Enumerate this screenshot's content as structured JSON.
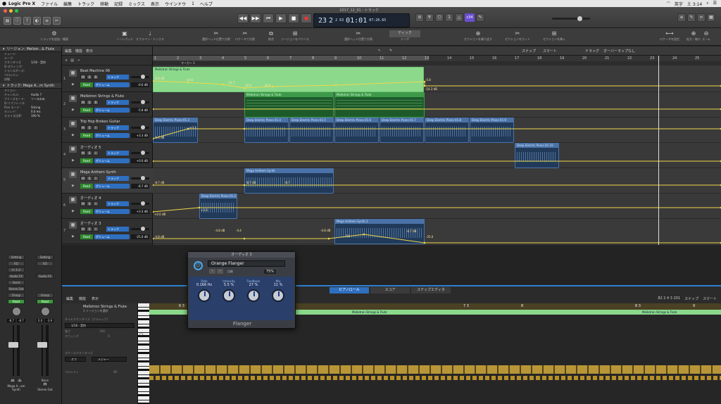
{
  "menubar": {
    "app": "Logic Pro X",
    "items": [
      "ファイル",
      "編集",
      "トラック",
      "移動",
      "記録",
      "ミックス",
      "表示",
      "ウインドウ",
      "1",
      "ヘルプ"
    ],
    "right": [
      "英字",
      "土 3:14"
    ]
  },
  "window": {
    "title": "2017_12_01 - トラック"
  },
  "lcd": {
    "bar": "23",
    "beat": "2",
    "sub": "2",
    "tick": "63",
    "time": "01:01",
    "ms": "07:20.65"
  },
  "cpu_badge": "c34",
  "toolbar": {
    "items": [
      "トラックを追加／複製",
      "ノートパッド",
      "オフライン・ミックス",
      "選択ヘッド位置で分割",
      "ロケータで分割",
      "結合",
      "リージョンをバウンス",
      "選択ヘッド位置で分割",
      "ティック",
      "テンポ",
      "セクションを繰り返す",
      "セクションをカット",
      "セクションを挿入",
      "ロケータを設定",
      "拡大／縮小",
      "ズーム"
    ]
  },
  "inspector": {
    "region_label": "リージョン: Mellotr...& Flute",
    "rows": [
      {
        "k": "ミュート:",
        "v": ""
      },
      {
        "k": "ループ:",
        "v": ""
      },
      {
        "k": "クオンタイズ",
        "v": "1/16 - 音符"
      },
      {
        "k": "Q-スウィング:",
        "v": ""
      },
      {
        "k": "トランスポーズ:",
        "v": ""
      },
      {
        "k": "ベロシティ:",
        "v": ""
      },
      {
        "k": "詳細",
        "v": ""
      }
    ],
    "track_label": "トラック: Mega A...m Synth",
    "track_rows": [
      {
        "k": "アイコン:",
        "v": ""
      },
      {
        "k": "チャンネル:",
        "v": "Audio 7"
      },
      {
        "k": "フリーズモード:",
        "v": "ソースのみ"
      },
      {
        "k": "Q-リファレンス:",
        "v": ""
      },
      {
        "k": "Flex モード:",
        "v": "Slicing"
      },
      {
        "k": "ディレイ:",
        "v": "0.0 ms"
      },
      {
        "k": "スライス比率:",
        "v": "100 %"
      }
    ]
  },
  "strips": [
    {
      "setting": "Setting",
      "eq": "EQ",
      "input": "In 1-2",
      "fx": "Audio FX",
      "send": "Send",
      "out": "Stereo Out",
      "group": "Group",
      "auto": "Read",
      "db1": "-8.7",
      "db2": "-8.7",
      "name": "Mega A...am Synth"
    },
    {
      "setting": "Setting",
      "eq": "EQ",
      "input": "",
      "fx": "Audio FX",
      "send": "",
      "out": "",
      "group": "Group",
      "auto": "Read",
      "db1": "0.0",
      "db2": "-3.9",
      "name": "Stereo Out",
      "bnce": "Bnce"
    }
  ],
  "tracklist": {
    "top": [
      "編集",
      "機能",
      "表示"
    ],
    "tracks": [
      {
        "num": "1",
        "name": "Beat Machine 06",
        "btn": "トラック",
        "auto": "Read",
        "vol": "ボリューム",
        "db": "-6.6 dB"
      },
      {
        "num": "2",
        "name": "Mellotron Strings & Flute",
        "btn": "トラック",
        "auto": "Read",
        "vol": "ボリューム",
        "db": "-5.8 dB"
      },
      {
        "num": "3",
        "name": "Trip Hop Broken Guitar",
        "btn": "トラック",
        "auto": "Read",
        "vol": "ボリューム",
        "db": "+3.3 dB"
      },
      {
        "num": "4",
        "name": "オーディオ 5",
        "btn": "トラック",
        "auto": "Read",
        "vol": "ボリューム",
        "db": "+0.0 dB"
      },
      {
        "num": "5",
        "name": "Mega Anthem Synth",
        "btn": "トラック",
        "auto": "Read",
        "vol": "ボリューム",
        "db": "-8.7 dB"
      },
      {
        "num": "6",
        "name": "オーディオ 4",
        "btn": "トラック",
        "auto": "Read",
        "vol": "ボリューム",
        "db": "+3.3 dB"
      },
      {
        "num": "7",
        "name": "オーディオ 3",
        "btn": "トラック",
        "auto": "Read",
        "vol": "ボリューム",
        "db": "-25.0 dB"
      }
    ]
  },
  "arrange": {
    "snap": "スナップ",
    "snap_val": "スマート",
    "drag": "ドラッグ",
    "drag_val": "オーバーラップなし",
    "ruler": [
      "1",
      "2",
      "3",
      "4",
      "5",
      "6",
      "7",
      "8",
      "9",
      "10",
      "11",
      "12",
      "13",
      "14",
      "15",
      "16",
      "17",
      "18",
      "19",
      "20",
      "21",
      "22",
      "23",
      "24",
      "25"
    ],
    "marker": "マーカー 1",
    "regions": {
      "mellotron_head": "Mellotron Strings & Flute",
      "mellotron_a": "Mellotron Strings & Flute",
      "mellotron_b": "Mellotron Strings & Flute",
      "dep": [
        "Deep Electric Piano 01.3",
        "Deep Electric Piano 01.4",
        "Deep Electric Piano 01.5",
        "Deep Electric Piano 01.6",
        "Deep Electric Piano 01.7",
        "Deep Electric Piano 01.8",
        "Deep Electric Piano 01.9"
      ],
      "dep10": "Deep Electric Piano 01.10",
      "mega5": "Mega Anthem Synth",
      "dep2": "Deep Electric Piano 01.2",
      "mega1": "Mega Anthem Synth.1"
    },
    "auto_labels": {
      "t1": [
        "-6.6 dB",
        "-10.6",
        "-14.7",
        "-20.0",
        "-30.9",
        "-5.8",
        "-14.3 dB"
      ],
      "t3": [
        "-6.6 dB",
        "+3.3"
      ],
      "t5": [
        "-8.7 dB",
        "-8.7 dB",
        "-8.7"
      ],
      "t6": [
        "+0.0 dB",
        "+3.3"
      ],
      "t7": [
        "-4.8 dB",
        "-4.8 dB",
        "-4.4",
        "-4.8 dB",
        "-6.7 dB",
        "-25.0",
        "-7.8"
      ]
    }
  },
  "lower": {
    "tabs": [
      "ピアノロール",
      "スコア",
      "ステップエディタ"
    ],
    "menu": [
      "編集",
      "機能",
      "表示"
    ],
    "region_name": "Mellotron Strings & Flute",
    "region_sub": "1 リージョンを選択",
    "labels": [
      "タイムクオンタイズ（クラシック）",
      "強さ",
      "スウィング",
      "スケールクオンタイズ",
      "ベロシティ"
    ],
    "quantize": "1/16 - 音符",
    "strength": "100",
    "swing": "0",
    "scale_off": "オフ",
    "scale_major": "メジャー",
    "velocity": "96",
    "pos": "82 2 4 3 201",
    "snap": "スナップ",
    "snap_val": "スマート",
    "ruler": [
      "6 3",
      "7",
      "7 3",
      "8",
      "8 3",
      "9"
    ],
    "band": "Mellotron Strings & Flute",
    "key": "C3"
  },
  "plugin": {
    "title": "オーディオ 3",
    "preset": "Orange Flanger",
    "compare": "比較",
    "mix": "75%",
    "knobs": [
      {
        "label": "Rate",
        "value": "0.166",
        "unit": "Hz"
      },
      {
        "label": "Intensity",
        "value": "5.5",
        "unit": "%"
      },
      {
        "label": "Feedback",
        "value": "27",
        "unit": "%"
      },
      {
        "label": "Mix",
        "value": "11",
        "unit": "%"
      }
    ],
    "name": "Flanger"
  },
  "colors": {
    "accent": "#2f6fc0",
    "region_green": "#1d5a2a",
    "region_blue": "#213a59",
    "automation": "#f0d84a"
  }
}
